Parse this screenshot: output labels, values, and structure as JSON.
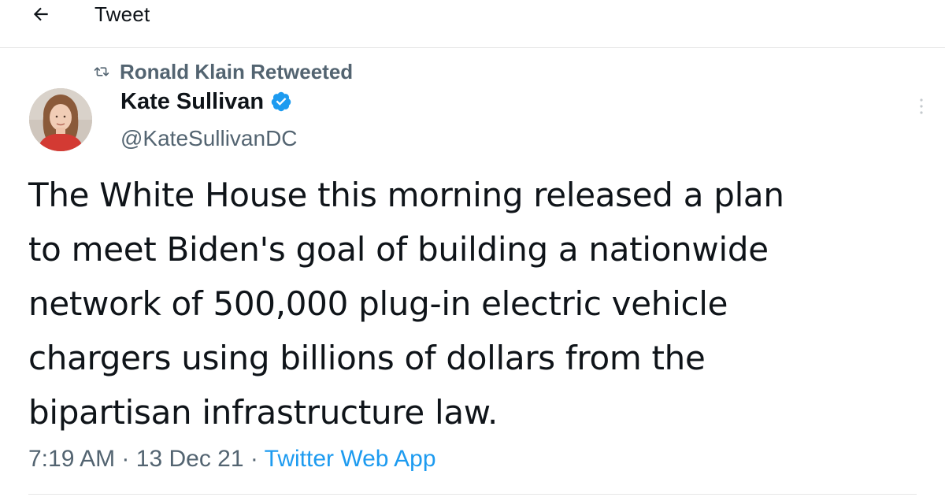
{
  "header": {
    "back_icon": "arrow-left-icon",
    "title": "Tweet"
  },
  "retweet": {
    "icon": "retweet-icon",
    "text": "Ronald Klain Retweeted"
  },
  "author": {
    "name": "Kate Sullivan",
    "handle": "@KateSullivanDC",
    "verified": true
  },
  "tweet": {
    "lines": [
      "The White House this morning released a plan",
      "to meet Biden's goal of building a nationwide",
      "network of 500,000 plug-in electric vehicle",
      "chargers using billions of dollars from the",
      "bipartisan infrastructure law."
    ],
    "time": "7:19 AM",
    "separator": "·",
    "date": "13 Dec 21",
    "source": "Twitter Web App"
  },
  "colors": {
    "text_primary": "#0f1419",
    "text_secondary": "#536471",
    "link_blue": "#1d9bf0",
    "divider": "#e6e6e6"
  }
}
